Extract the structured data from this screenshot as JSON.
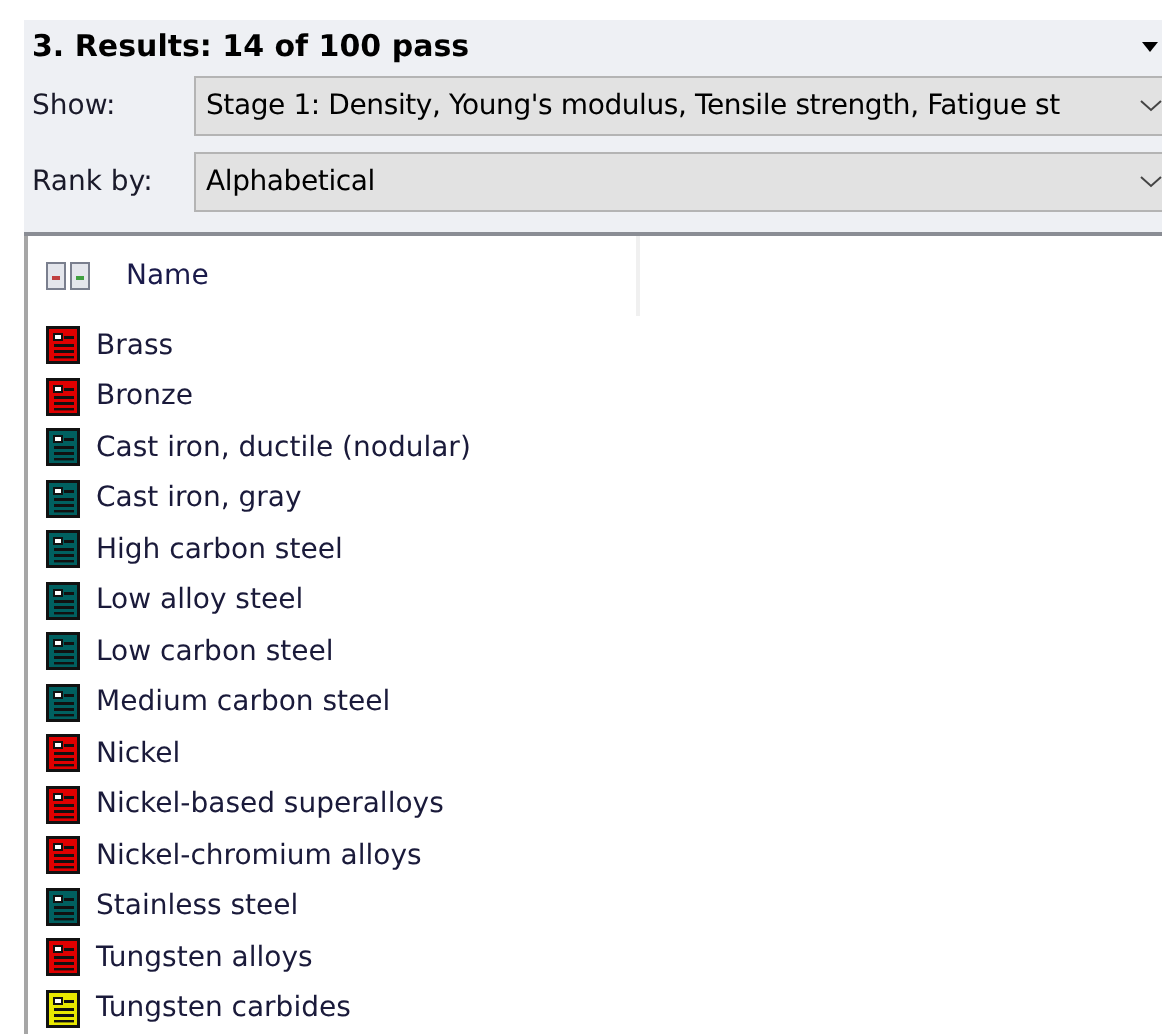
{
  "panel": {
    "title": "3. Results: 14 of 100 pass"
  },
  "show": {
    "label": "Show:",
    "value": "Stage 1: Density, Young's modulus, Tensile strength, Fatigue st"
  },
  "rank_by": {
    "label": "Rank by:",
    "value": "Alphabetical"
  },
  "table": {
    "columns": [
      "Name"
    ],
    "rows": [
      {
        "name": "Brass",
        "color": "#e00000"
      },
      {
        "name": "Bronze",
        "color": "#e00000"
      },
      {
        "name": "Cast iron, ductile (nodular)",
        "color": "#006060"
      },
      {
        "name": "Cast iron, gray",
        "color": "#006060"
      },
      {
        "name": "High carbon steel",
        "color": "#006060"
      },
      {
        "name": "Low alloy steel",
        "color": "#006060"
      },
      {
        "name": "Low carbon steel",
        "color": "#006060"
      },
      {
        "name": "Medium carbon steel",
        "color": "#006060"
      },
      {
        "name": "Nickel",
        "color": "#e00000"
      },
      {
        "name": "Nickel-based superalloys",
        "color": "#e00000"
      },
      {
        "name": "Nickel-chromium alloys",
        "color": "#e00000"
      },
      {
        "name": "Stainless steel",
        "color": "#006060"
      },
      {
        "name": "Tungsten alloys",
        "color": "#e00000"
      },
      {
        "name": "Tungsten carbides",
        "color": "#e8e800"
      }
    ]
  }
}
